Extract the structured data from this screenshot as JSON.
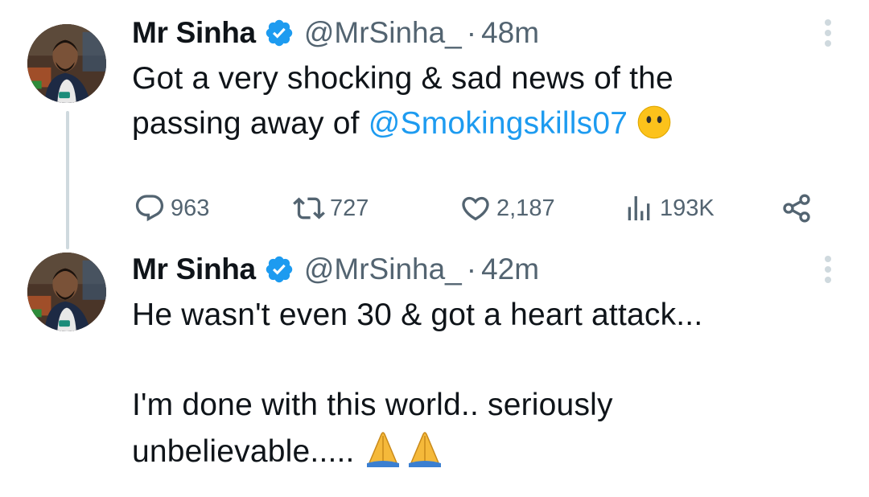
{
  "tweets": [
    {
      "name": "Mr Sinha",
      "handle": "@MrSinha_",
      "separator": "·",
      "time": "48m",
      "text_part1": "Got a very shocking  & sad news of the",
      "text_part2": "passing away of ",
      "mention": "@Smokingskills07",
      "emoji_icon": "face-without-mouth-emoji",
      "replies": "963",
      "retweets": "727",
      "likes": "2,187",
      "views": "193K"
    },
    {
      "name": "Mr Sinha",
      "handle": "@MrSinha_",
      "separator": "·",
      "time": "42m",
      "line1": "He wasn't even 30 & got a heart attack...",
      "line2": "I'm done with this world.. seriously",
      "line3": "unbelievable.....",
      "emoji_icon": "folded-hands-emoji"
    }
  ],
  "colors": {
    "accent": "#1d9bf0",
    "secondary_text": "#536471",
    "thread_line": "#cfd9de"
  }
}
